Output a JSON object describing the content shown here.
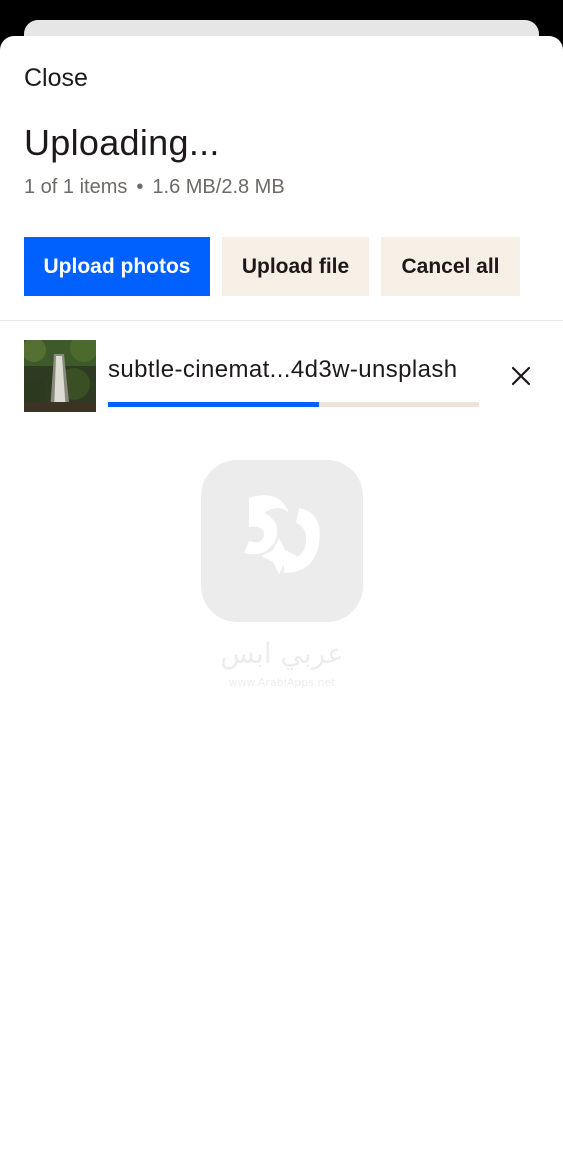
{
  "sheet": {
    "close_label": "Close",
    "title": "Uploading...",
    "items_count": "1 of 1 items",
    "separator": "•",
    "size_progress": "1.6 MB/2.8 MB"
  },
  "actions": {
    "upload_photos_label": "Upload photos",
    "upload_file_label": "Upload file",
    "cancel_all_label": "Cancel all"
  },
  "upload_item": {
    "filename": "subtle-cinemat...4d3w-unsplash",
    "progress": 0.57,
    "thumbnail_icon": "waterfall-photo-thumbnail",
    "remove_icon": "close-icon"
  },
  "watermark": {
    "text_ar": "عربي ابس",
    "url": "www.ArabiApps.net"
  },
  "colors": {
    "primary": "#0061fe",
    "secondary_bg": "#f5efe6",
    "text": "#1e1919",
    "muted_text": "#6d6a68",
    "progress_track": "#ebe4d8"
  }
}
